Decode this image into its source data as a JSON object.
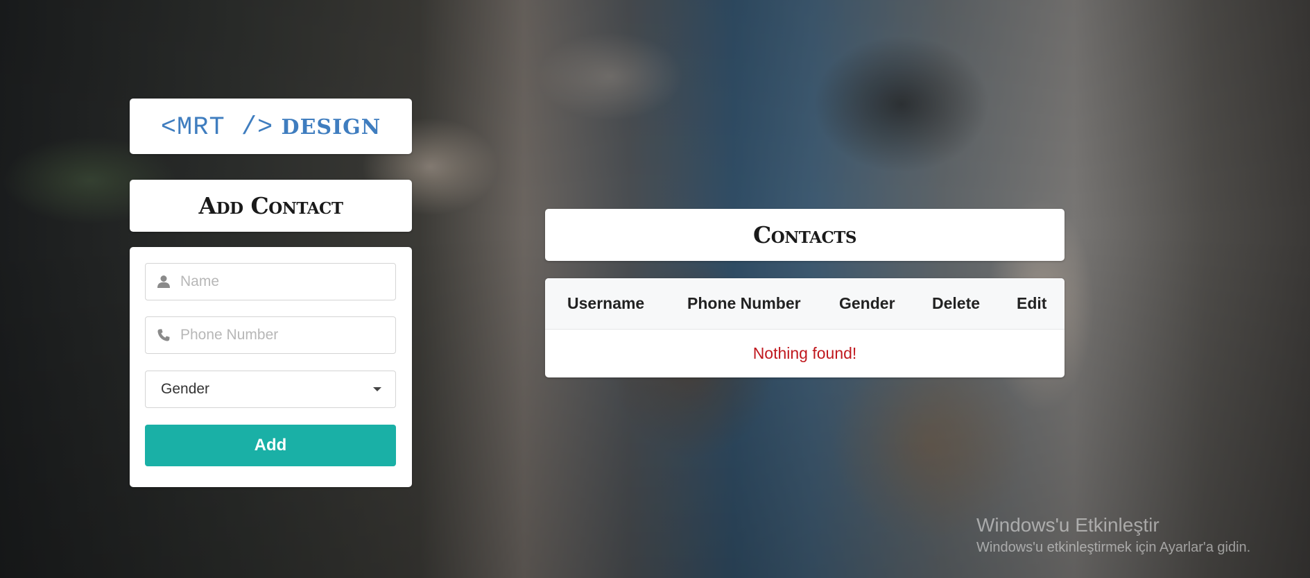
{
  "logo": {
    "code": "<MRT />",
    "design": "DESIGN"
  },
  "add_contact": {
    "title": "Add Contact",
    "name_placeholder": "Name",
    "phone_placeholder": "Phone Number",
    "gender_label": "Gender",
    "add_label": "Add"
  },
  "contacts": {
    "title": "Contacts",
    "columns": [
      "Username",
      "Phone Number",
      "Gender",
      "Delete",
      "Edit"
    ],
    "empty_message": "Nothing found!"
  },
  "watermark": {
    "title": "Windows'u Etkinleştir",
    "subtitle": "Windows'u etkinleştirmek için Ayarlar'a gidin."
  },
  "colors": {
    "accent": "#1ab0a6",
    "logo": "#3f7dbf",
    "empty_message": "#c0181e"
  },
  "icons": {
    "name_field": "user-icon",
    "phone_field": "phone-icon",
    "gender_select": "caret-down-icon"
  }
}
